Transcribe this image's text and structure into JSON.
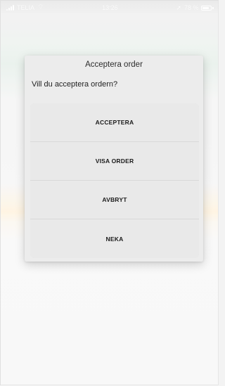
{
  "status_bar": {
    "carrier": "TELIA",
    "time": "13:26",
    "battery_text": "78 %",
    "battery_level": 0.78,
    "icons": [
      "signal-icon",
      "wifi-icon",
      "location-icon",
      "battery-icon"
    ]
  },
  "dialog": {
    "title": "Acceptera order",
    "message": "Vill du acceptera ordern?",
    "options": [
      {
        "label": "ACCEPTERA"
      },
      {
        "label": "VISA ORDER"
      },
      {
        "label": "AVBRYT"
      },
      {
        "label": "NEKA"
      }
    ]
  },
  "colors": {
    "dialog_background": "#ececec",
    "option_text": "#1b1b1b",
    "background_accent_green": "#e6f0ea",
    "background_accent_orange": "#fff2dd"
  }
}
